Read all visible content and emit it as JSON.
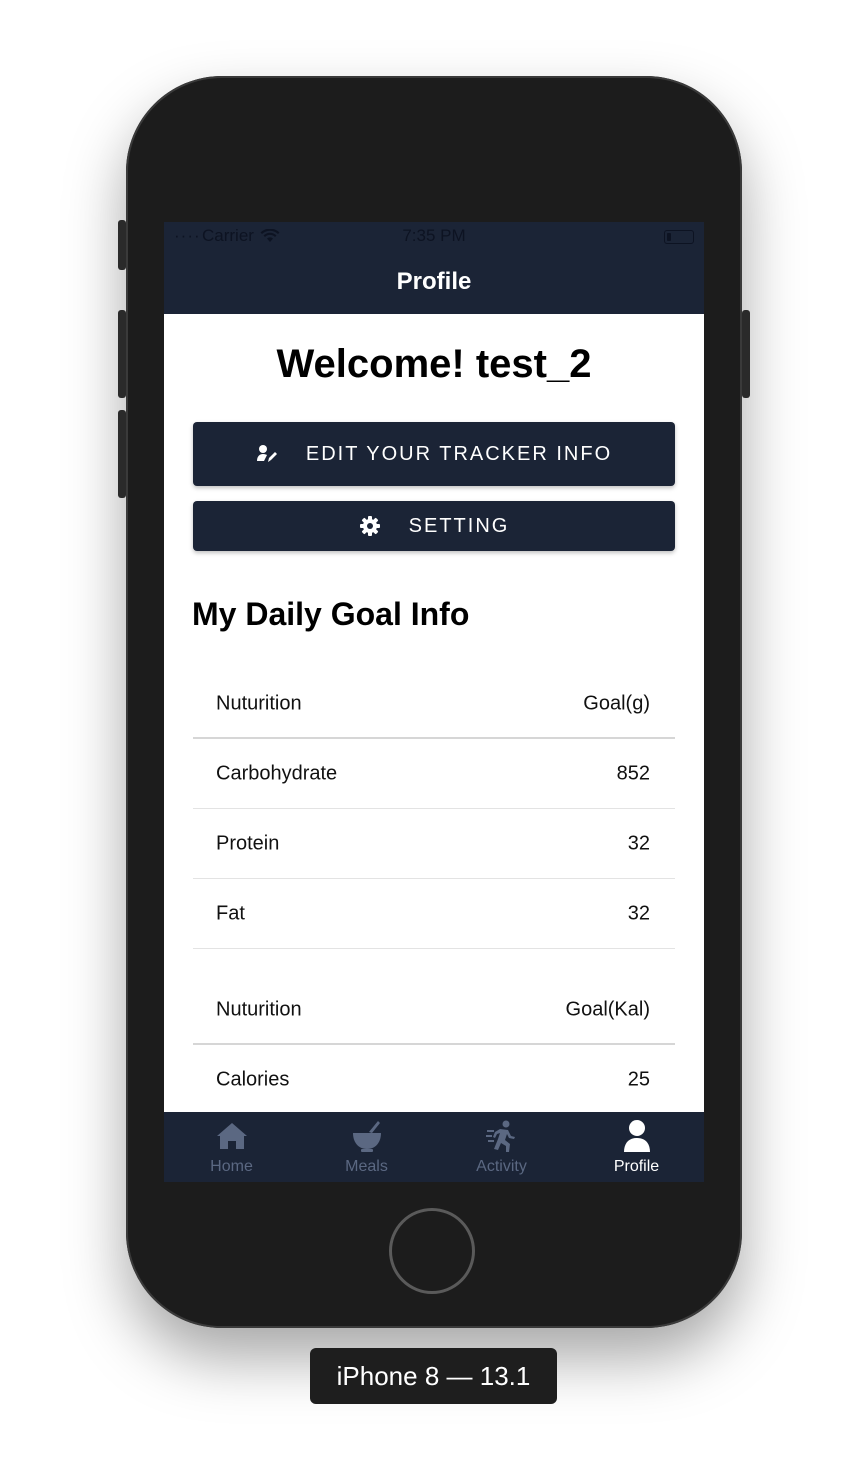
{
  "status_bar": {
    "carrier": "Carrier",
    "time": "7:35 PM",
    "icons": [
      "signal-dots-icon",
      "wifi-icon",
      "battery-icon"
    ]
  },
  "header": {
    "title": "Profile"
  },
  "welcome_text": "Welcome! test_2",
  "buttons": {
    "edit_tracker": {
      "label": "EDIT YOUR TRACKER INFO",
      "icon": "user-edit-icon"
    },
    "setting": {
      "label": "SETTING",
      "icon": "gear-icon"
    }
  },
  "section_title": "My Daily Goal Info",
  "nutrition_table": {
    "headers": [
      "Nuturition",
      "Goal(g)"
    ],
    "rows": [
      [
        "Carbohydrate",
        "852"
      ],
      [
        "Protein",
        "32"
      ],
      [
        "Fat",
        "32"
      ]
    ]
  },
  "calories_table": {
    "headers": [
      "Nuturition",
      "Goal(Kal)"
    ],
    "rows": [
      [
        "Calories",
        "25"
      ]
    ]
  },
  "tab_bar": {
    "tabs": [
      {
        "label": "Home",
        "icon": "home-icon",
        "active": false
      },
      {
        "label": "Meals",
        "icon": "bowl-icon",
        "active": false
      },
      {
        "label": "Activity",
        "icon": "running-icon",
        "active": false
      },
      {
        "label": "Profile",
        "icon": "user-icon",
        "active": true
      }
    ]
  },
  "simulator_label": "iPhone 8 — 13.1",
  "colors": {
    "navy": "#1b2436",
    "tab_inactive": "#5b6882",
    "tab_active": "#ffffff"
  }
}
